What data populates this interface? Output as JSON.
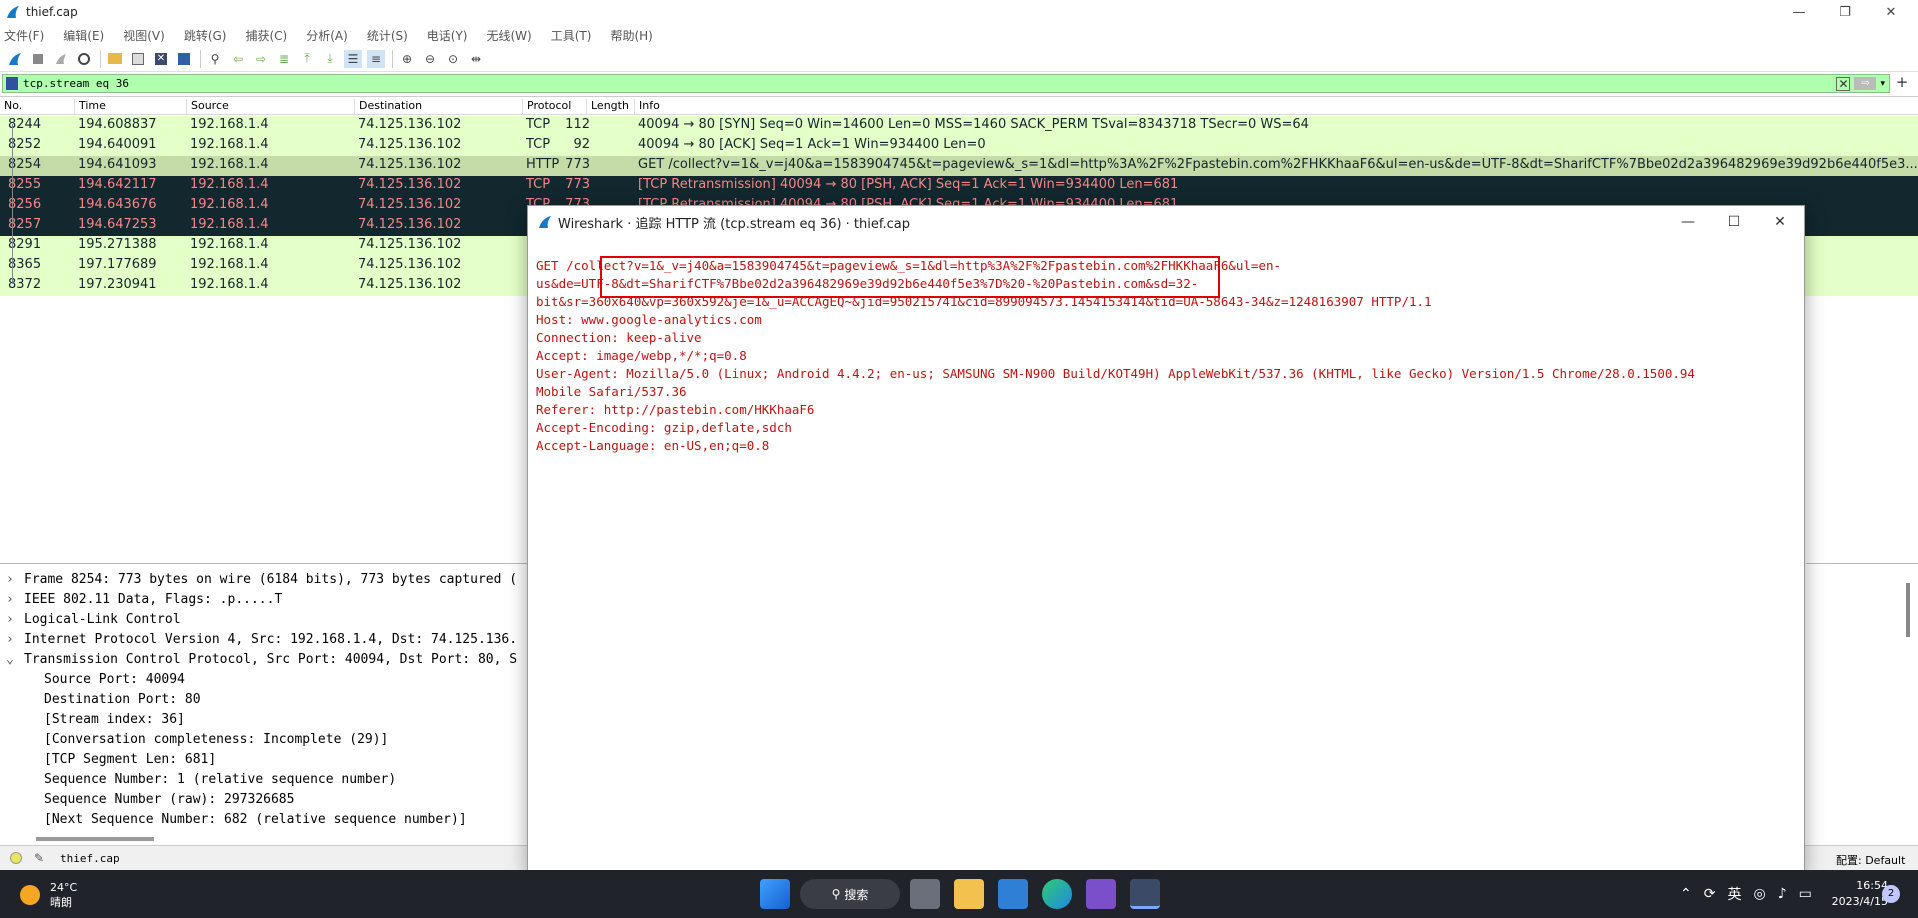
{
  "window": {
    "title": "thief.cap"
  },
  "menu": [
    "文件(F)",
    "编辑(E)",
    "视图(V)",
    "跳转(G)",
    "捕获(C)",
    "分析(A)",
    "统计(S)",
    "电话(Y)",
    "无线(W)",
    "工具(T)",
    "帮助(H)"
  ],
  "filter": {
    "value": "tcp.stream eq 36"
  },
  "packet_list": {
    "headers": [
      "No.",
      "Time",
      "Source",
      "Destination",
      "Protocol",
      "Length",
      "Info"
    ],
    "rows": [
      {
        "no": "8244",
        "time": "194.608837",
        "src": "192.168.1.4",
        "dst": "74.125.136.102",
        "proto": "TCP",
        "len": "112",
        "info": "40094 → 80 [SYN] Seq=0 Win=14600 Len=0 MSS=1460 SACK_PERM TSval=8343718 TSecr=0 WS=64",
        "style": "green"
      },
      {
        "no": "8252",
        "time": "194.640091",
        "src": "192.168.1.4",
        "dst": "74.125.136.102",
        "proto": "TCP",
        "len": "92",
        "info": "40094 → 80 [ACK] Seq=1 Ack=1 Win=934400 Len=0",
        "style": "green"
      },
      {
        "no": "8254",
        "time": "194.641093",
        "src": "192.168.1.4",
        "dst": "74.125.136.102",
        "proto": "HTTP",
        "len": "773",
        "info": "GET /collect?v=1&_v=j40&a=1583904745&t=pageview&_s=1&dl=http%3A%2F%2Fpastebin.com%2FHKKhaaF6&ul=en-us&de=UTF-8&dt=SharifCTF%7Bbe02d2a396482969e39d92b6e440f5e3...",
        "style": "sel"
      },
      {
        "no": "8255",
        "time": "194.642117",
        "src": "192.168.1.4",
        "dst": "74.125.136.102",
        "proto": "TCP",
        "len": "773",
        "info": "[TCP Retransmission] 40094 → 80 [PSH, ACK] Seq=1 Ack=1 Win=934400 Len=681",
        "style": "dark"
      },
      {
        "no": "8256",
        "time": "194.643676",
        "src": "192.168.1.4",
        "dst": "74.125.136.102",
        "proto": "TCP",
        "len": "773",
        "info": "[TCP Retransmission] 40094 → 80 [PSH, ACK] Seq=1 Ack=1 Win=934400 Len=681",
        "style": "dark"
      },
      {
        "no": "8257",
        "time": "194.647253",
        "src": "192.168.1.4",
        "dst": "74.125.136.102",
        "proto": "",
        "len": "",
        "info": "",
        "style": "dark"
      },
      {
        "no": "8291",
        "time": "195.271388",
        "src": "192.168.1.4",
        "dst": "74.125.136.102",
        "proto": "",
        "len": "",
        "info": "",
        "style": "green"
      },
      {
        "no": "8365",
        "time": "197.177689",
        "src": "192.168.1.4",
        "dst": "74.125.136.102",
        "proto": "",
        "len": "",
        "info": "",
        "style": "green"
      },
      {
        "no": "8372",
        "time": "197.230941",
        "src": "192.168.1.4",
        "dst": "74.125.136.102",
        "proto": "",
        "len": "",
        "info": "",
        "style": "green"
      }
    ]
  },
  "details": [
    {
      "arrow": "›",
      "text": "Frame 8254: 773 bytes on wire (6184 bits), 773 bytes captured ("
    },
    {
      "arrow": "›",
      "text": "IEEE 802.11 Data, Flags: .p.....T"
    },
    {
      "arrow": "›",
      "text": "Logical-Link Control"
    },
    {
      "arrow": "›",
      "text": "Internet Protocol Version 4, Src: 192.168.1.4, Dst: 74.125.136."
    },
    {
      "arrow": "⌄",
      "text": "Transmission Control Protocol, Src Port: 40094, Dst Port: 80, S"
    },
    {
      "arrow": "",
      "text": "Source Port: 40094"
    },
    {
      "arrow": "",
      "text": "Destination Port: 80"
    },
    {
      "arrow": "",
      "text": "[Stream index: 36]"
    },
    {
      "arrow": "",
      "text": "[Conversation completeness: Incomplete (29)]"
    },
    {
      "arrow": "",
      "text": "[TCP Segment Len: 681]"
    },
    {
      "arrow": "",
      "text": "Sequence Number: 1    (relative sequence number)"
    },
    {
      "arrow": "",
      "text": "Sequence Number (raw): 297326685"
    },
    {
      "arrow": "",
      "text": "[Next Sequence Number: 682    (relative sequence number)]"
    }
  ],
  "status": {
    "file": "thief.cap",
    "profile": "配置: Default"
  },
  "dialog": {
    "title": "Wireshark · 追踪 HTTP 流 (tcp.stream eq 36) · thief.cap",
    "lines": [
      "GET /collect?v=1&_v=j40&a=1583904745&t=pageview&_s=1&dl=http%3A%2F%2Fpastebin.com%2FHKKhaaF6&ul=en-",
      "us&de=UTF-8&dt=SharifCTF%7Bbe02d2a396482969e39d92b6e440f5e3%7D%20-%20Pastebin.com&sd=32-",
      "bit&sr=360x640&vp=360x592&je=1&_u=ACCAgEQ~&jid=950215741&cid=899094573.1454153414&tid=UA-58643-34&z=1248163907 HTTP/1.1",
      "Host: www.google-analytics.com",
      "Connection: keep-alive",
      "Accept: image/webp,*/*;q=0.8",
      "User-Agent: Mozilla/5.0 (Linux; Android 4.4.2; en-us; SAMSUNG SM-N900 Build/KOT49H) AppleWebKit/537.36 (KHTML, like Gecko) Version/1.5 Chrome/28.0.1500.94",
      "Mobile Safari/537.36",
      "Referer: http://pastebin.com/HKKhaaF6",
      "Accept-Encoding: gzip,deflate,sdch",
      "Accept-Language: en-US,en;q=0.8"
    ]
  },
  "taskbar": {
    "temp": "24°C",
    "weather": "晴朗",
    "search": "搜索",
    "ime": "英",
    "time": "16:54",
    "date": "2023/4/15",
    "notifications": "2"
  }
}
